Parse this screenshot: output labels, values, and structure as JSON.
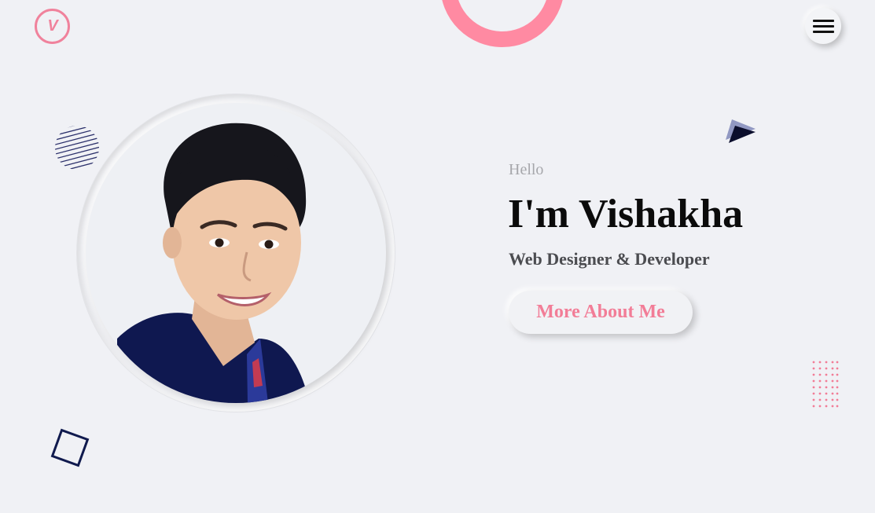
{
  "header": {
    "logo_text": "V",
    "menu_icon": "hamburger-icon"
  },
  "hero": {
    "greeting": "Hello",
    "headline": "I'm Vishakha",
    "subtitle": "Web Designer & Developer",
    "cta_label": "More About Me",
    "profile_photo_alt": "Vishakha"
  },
  "colors": {
    "accent_pink": "#f27d97",
    "ring_pink": "#ff8aa2",
    "navy": "#101a4e",
    "background": "#f0f1f5"
  }
}
